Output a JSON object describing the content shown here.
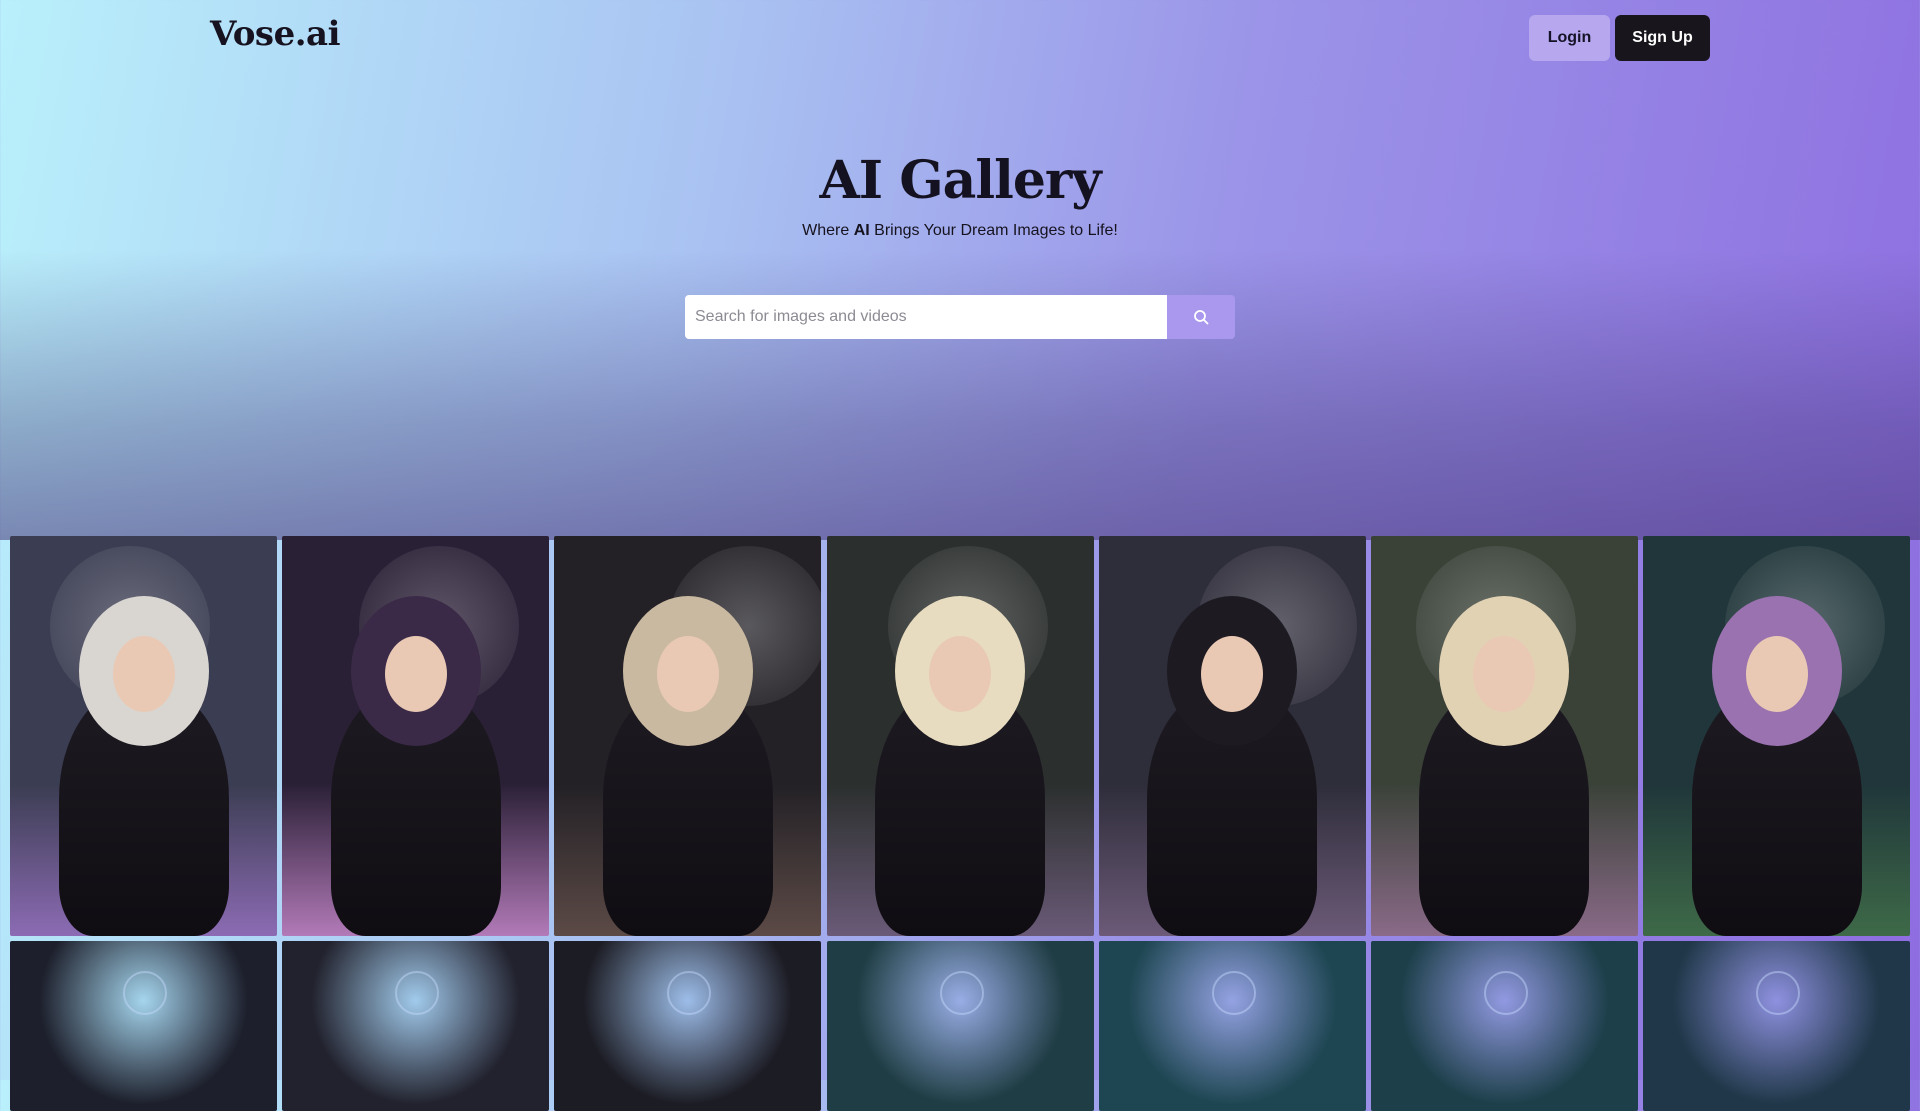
{
  "header": {
    "logo": "Vose.ai",
    "login_label": "Login",
    "signup_label": "Sign Up"
  },
  "hero": {
    "title": "AI Gallery",
    "subtitle_prefix": "Where ",
    "subtitle_bold": "AI",
    "subtitle_suffix": " Brings Your Dream Images to Life!"
  },
  "search": {
    "placeholder": "Search for images and videos",
    "value": "",
    "button_icon": "search-icon"
  },
  "colors": {
    "accent": "#aa98ee",
    "signup_bg": "#18161c",
    "login_bg": "#b6a7ee"
  },
  "gallery": {
    "row1": [
      {
        "theme": "forest-elf-silver-hair",
        "bg": "#3b3d52",
        "hair": "#d9d6d2",
        "ground": "#8c6bb4"
      },
      {
        "theme": "moon-elf-purple-hair",
        "bg": "#2a2036",
        "hair": "#3a2a48",
        "ground": "#b27ab8"
      },
      {
        "theme": "dark-blonde-flowers",
        "bg": "#232126",
        "hair": "#c9b9a0",
        "ground": "#5c4a46"
      },
      {
        "theme": "forest-blonde-elf",
        "bg": "#2b2f2d",
        "hair": "#e8dcc0",
        "ground": "#6a5a78"
      },
      {
        "theme": "moon-dark-hair",
        "bg": "#2e2d3a",
        "hair": "#1d1a22",
        "ground": "#6c5a78"
      },
      {
        "theme": "forest-blonde-sitting",
        "bg": "#3a4238",
        "hair": "#e2d2b4",
        "ground": "#8a6a88"
      },
      {
        "theme": "tower-purple-hair",
        "bg": "#20363a",
        "hair": "#9a72b0",
        "ground": "#3e6a48"
      }
    ],
    "row2": [
      {
        "theme": "dark-orb",
        "bg": "#1d1f2c"
      },
      {
        "theme": "dark-flower-moon",
        "bg": "#22222e"
      },
      {
        "theme": "silver-swirl-hair",
        "bg": "#1c1c24"
      },
      {
        "theme": "underwater-blue",
        "bg": "#1f3d44"
      },
      {
        "theme": "underwater-crown",
        "bg": "#1e4652"
      },
      {
        "theme": "underwater-creatures",
        "bg": "#1d3f4a"
      },
      {
        "theme": "dark-blue-face",
        "bg": "#1f3748"
      }
    ]
  }
}
